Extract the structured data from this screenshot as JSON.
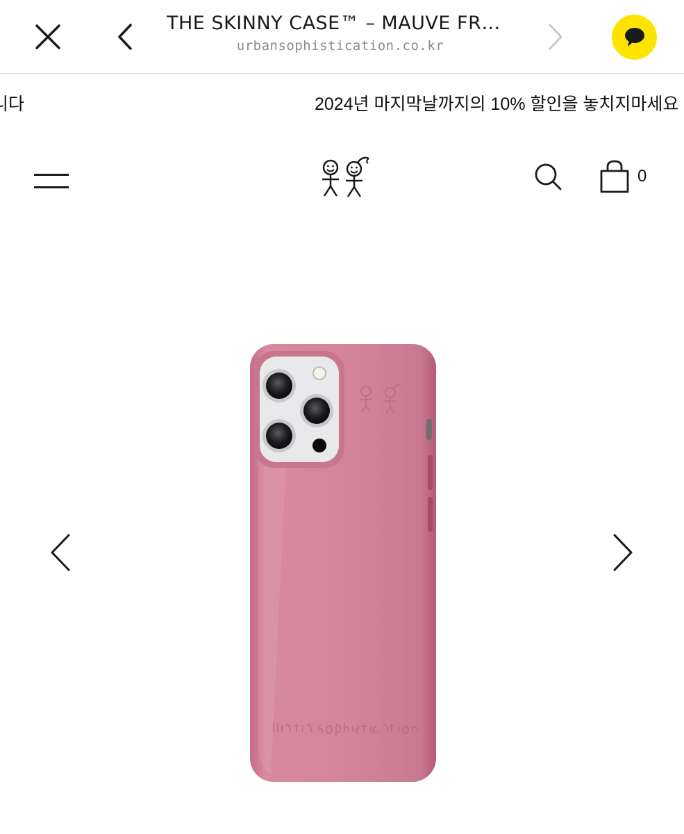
{
  "browser": {
    "title": "THE SKINNY CASE™ – MAUVE FRO...",
    "url": "urbansophistication.co.kr",
    "icons": {
      "close": "close-icon",
      "back": "chevron-left-icon",
      "forward": "chevron-right-icon",
      "share": "kakaotalk-icon"
    },
    "colors": {
      "kakao": "#FEE500"
    }
  },
  "announcement": {
    "prev_fragment": "니다",
    "text": "2024년 마지막날까지의 10% 할인을 놓치지마세요"
  },
  "header": {
    "icons": {
      "menu": "hamburger-menu-icon",
      "logo": "stick-figure-logo",
      "search": "search-icon",
      "cart": "shopping-bag-icon"
    },
    "cart_count": "0"
  },
  "gallery": {
    "icons": {
      "prev": "chevron-left-icon",
      "next": "chevron-right-icon"
    },
    "product": "pink glossy phone case",
    "colors": {
      "case": "#d3849a"
    }
  }
}
